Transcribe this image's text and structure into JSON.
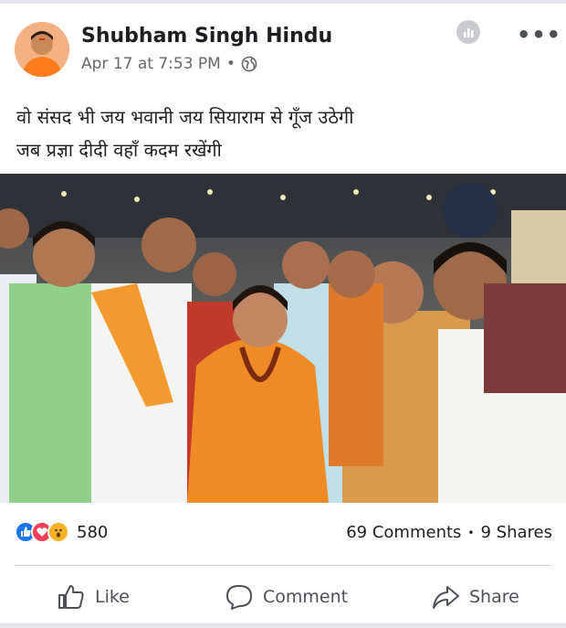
{
  "post": {
    "author": "Shubham Singh Hindu",
    "timestamp": "Apr 17 at 7:53 PM",
    "separator": "•",
    "text_lines": [
      "वो संसद भी जय भवानी जय सियाराम से  गूँज उठेगी",
      "जब प्रज्ञा दीदी वहाँ कदम रखेंगी"
    ]
  },
  "reactions": {
    "count": "580",
    "types": [
      "like-icon",
      "love-icon",
      "wow-icon"
    ]
  },
  "engagement": {
    "comments": "69 Comments",
    "separator": "•",
    "shares": "9 Shares"
  },
  "actions": {
    "like": "Like",
    "comment": "Comment",
    "share": "Share"
  },
  "colors": {
    "fb_blue": "#1877f2",
    "love_red": "#f33e58",
    "wow_yellow": "#f7b125",
    "text_secondary": "#65676b"
  }
}
